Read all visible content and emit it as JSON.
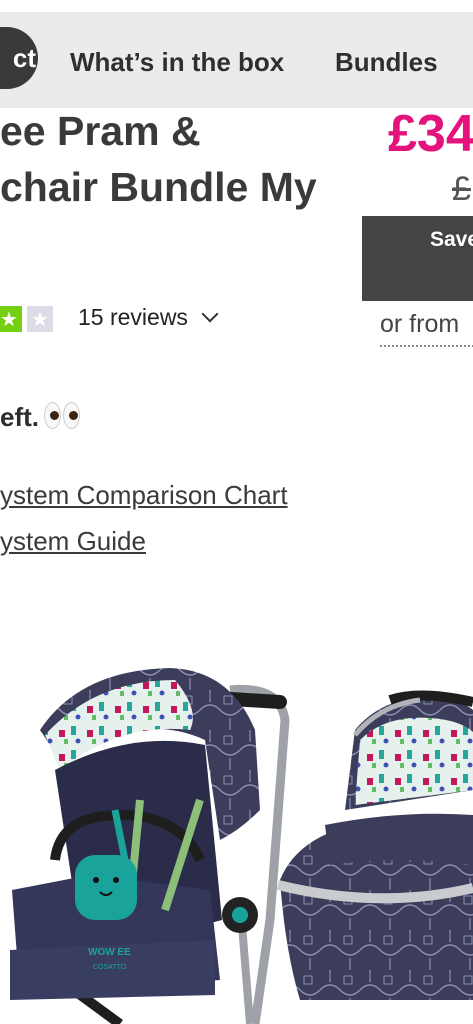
{
  "tabs": {
    "active": "ct",
    "whats_in_box": "What’s in the box",
    "bundles": "Bundles"
  },
  "product": {
    "title_line1": "ee Pram &",
    "title_line2": "chair Bundle My",
    "price": "£34",
    "was_price": "£",
    "save_label": "Save",
    "finance_text": "or from"
  },
  "reviews": {
    "stars_filled": 4,
    "stars_total": 5,
    "text": "15 reviews",
    "chevron": "⌄"
  },
  "stock": {
    "text": "eft.",
    "emoji_icon": "eyes-emoji"
  },
  "links": {
    "comparison": "ystem Comparison Chart",
    "guide": "ystem Guide"
  },
  "image": {
    "brand": "WOW EE",
    "sub": "COSATTO"
  },
  "colors": {
    "accent": "#e3127c",
    "star_green": "#73cf11",
    "star_grey": "#dcdce6",
    "tab_bg": "#ebebeb",
    "save_bg": "#444444"
  }
}
